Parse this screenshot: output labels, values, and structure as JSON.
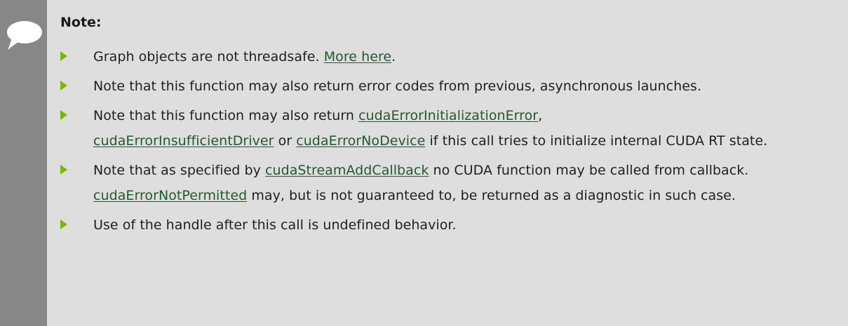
{
  "note": {
    "title": "Note:",
    "items": [
      {
        "text_1": "Graph objects are not threadsafe. ",
        "link_1": "More here",
        "text_2": "."
      },
      {
        "text_1": "Note that this function may also return error codes from previous, asynchronous launches."
      },
      {
        "text_1": "Note that this function may also return ",
        "link_1": "cudaErrorInitializationError",
        "text_2": ", ",
        "link_2": "cudaErrorInsufficientDriver",
        "text_3": " or ",
        "link_3": "cudaErrorNoDevice",
        "text_4": " if this call tries to initialize internal CUDA RT state."
      },
      {
        "text_1": "Note that as specified by ",
        "link_1": "cudaStreamAddCallback",
        "text_2": " no CUDA function may be called from callback. ",
        "link_2": "cudaErrorNotPermitted",
        "text_3": " may, but is not guaranteed to, be returned as a diagnostic in such case."
      },
      {
        "text_1": "Use of the handle after this call is undefined behavior."
      }
    ]
  },
  "colors": {
    "background": "#dedede",
    "sidebar": "#878787",
    "bullet": "#76b900",
    "link": "#1f5b2c"
  },
  "icons": {
    "note_icon": "speech-bubble-icon",
    "bullet_icon": "triangle-bullet-icon"
  }
}
